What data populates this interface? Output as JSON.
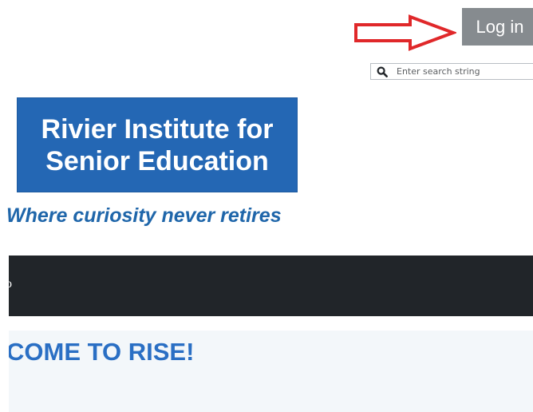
{
  "header": {
    "login_label": "Log in",
    "search": {
      "placeholder": "Enter search string",
      "value": ""
    },
    "annotation": {
      "arrow_color": "#e0282a"
    }
  },
  "branding": {
    "logo_line1": "Rivier Institute for",
    "logo_line2": "Senior Education",
    "tagline": "Where curiosity never retires",
    "logo_bg_color": "#2467b4",
    "tagline_color": "#1f66aa"
  },
  "navbar": {
    "visible_fragment": "o",
    "bg_color": "#212529"
  },
  "welcome": {
    "heading": "COME TO RISE!",
    "heading_color": "#2a6fc4"
  },
  "icons": {
    "search": "search-icon",
    "arrow": "right-arrow-icon"
  }
}
